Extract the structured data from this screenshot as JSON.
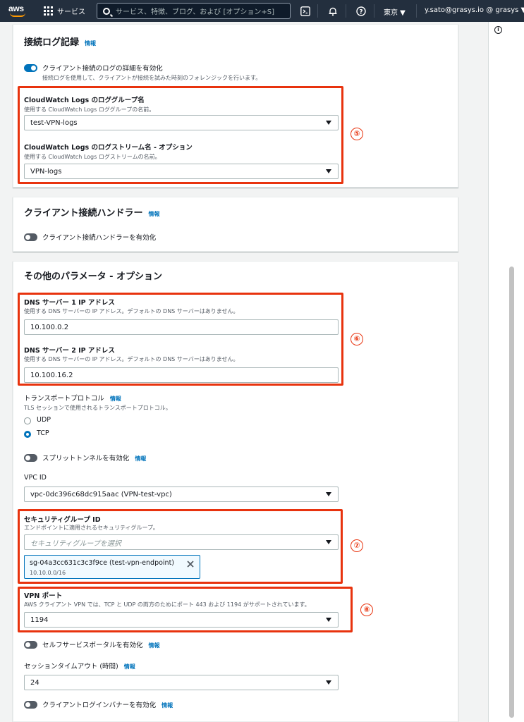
{
  "nav": {
    "logo": "aws",
    "services_label": "サービス",
    "search_placeholder": "サービス、特徴、ブログ、および [オプション+S]",
    "region": "東京 ▼",
    "account": "y.sato@grasys.io @ grasys ▼"
  },
  "log_section": {
    "title": "接続ログ記録",
    "info": "情報",
    "toggle_label": "クライアント接続のログの詳細を有効化",
    "toggle_desc": "接続ログを使用して、クライアントが接続を試みた時刻のフォレンジックを行います。",
    "log_group_label": "CloudWatch Logs のロググループ名",
    "log_group_desc": "使用する CloudWatch Logs ロググループの名前。",
    "log_group_value": "test-VPN-logs",
    "log_stream_label": "CloudWatch Logs のログストリーム名 - オプション",
    "log_stream_desc": "使用する CloudWatch Logs ログストリームの名前。",
    "log_stream_value": "VPN-logs",
    "annotation": "⑤"
  },
  "handler_section": {
    "title": "クライアント接続ハンドラー",
    "info": "情報",
    "toggle_label": "クライアント接続ハンドラーを有効化"
  },
  "other_section": {
    "title": "その他のパラメータ - オプション",
    "dns1_label": "DNS サーバー 1 IP アドレス",
    "dns1_desc": "使用する DNS サーバーの IP アドレス。デフォルトの DNS サーバーはありません。",
    "dns1_value": "10.100.0.2",
    "dns2_label": "DNS サーバー 2 IP アドレス",
    "dns2_desc": "使用する DNS サーバーの IP アドレス。デフォルトの DNS サーバーはありません。",
    "dns2_value": "10.100.16.2",
    "dns_annotation": "⑥",
    "transport_label": "トランスポートプロトコル",
    "transport_info": "情報",
    "transport_desc": "TLS セッションで使用されるトランスポートプロトコル。",
    "transport_options": [
      "UDP",
      "TCP"
    ],
    "split_label": "スプリットトンネルを有効化",
    "split_info": "情報",
    "vpc_label": "VPC ID",
    "vpc_value": "vpc-0dc396c68dc915aac (VPN-test-vpc)",
    "sg_label": "セキュリティグループ ID",
    "sg_desc": "エンドポイントに適用されるセキュリティグループ。",
    "sg_placeholder": "セキュリティグループを選択",
    "sg_token_name": "sg-04a3cc631c3c3f9ce (test-vpn-endpoint)",
    "sg_token_sub": "10.10.0.0/16",
    "sg_annotation": "⑦",
    "port_label": "VPN ポート",
    "port_desc": "AWS クライアント VPN では、TCP と UDP の両方のためにポート 443 および 1194 がサポートされています。",
    "port_value": "1194",
    "port_annotation": "⑧",
    "selfservice_label": "セルフサービスポータルを有効化",
    "selfservice_info": "情報",
    "timeout_label": "セッションタイムアウト (時間)",
    "timeout_info": "情報",
    "timeout_value": "24",
    "banner_label": "クライアントログインバナーを有効化",
    "banner_info": "情報"
  },
  "colors": {
    "nav_bg": "#232f3e",
    "accent": "#0073bb",
    "annotation_red": "#e8330e"
  }
}
